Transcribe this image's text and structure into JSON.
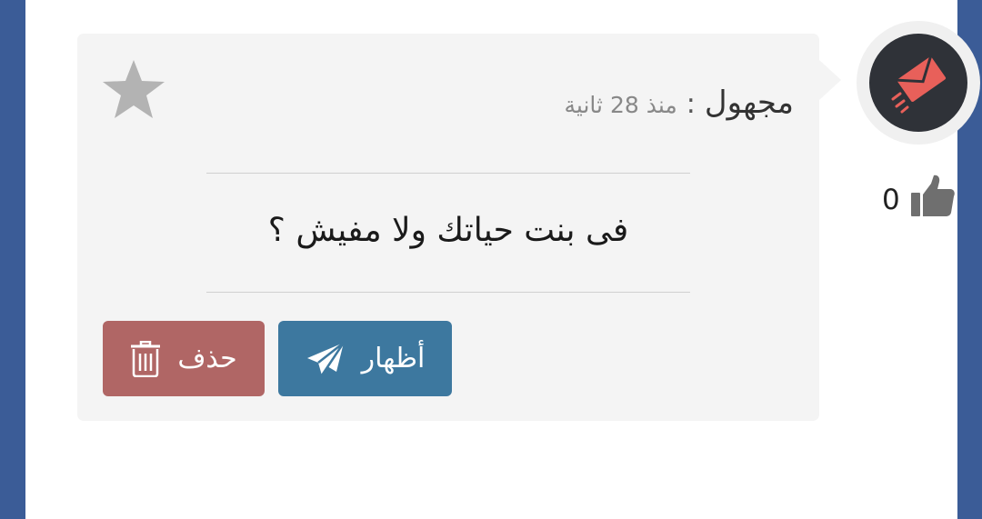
{
  "sender": {
    "name": "مجهول",
    "separator": ":",
    "time": "منذ 28 ثانية"
  },
  "message": {
    "text": "فى بنت حياتك ولا مفيش ؟"
  },
  "likes": {
    "count": "0"
  },
  "actions": {
    "show_label": "أظهار",
    "delete_label": "حذف"
  },
  "icons": {
    "avatar": "envelope-icon",
    "favorite": "star-icon",
    "like": "thumbs-up-icon",
    "show": "paper-plane-icon",
    "delete": "trash-icon"
  },
  "colors": {
    "frame": "#3b5c97",
    "show_button": "#3d789f",
    "delete_button": "#b06665",
    "avatar_bg": "#2f3238",
    "avatar_envelope": "#e8605a",
    "star": "#b3b3b3"
  }
}
